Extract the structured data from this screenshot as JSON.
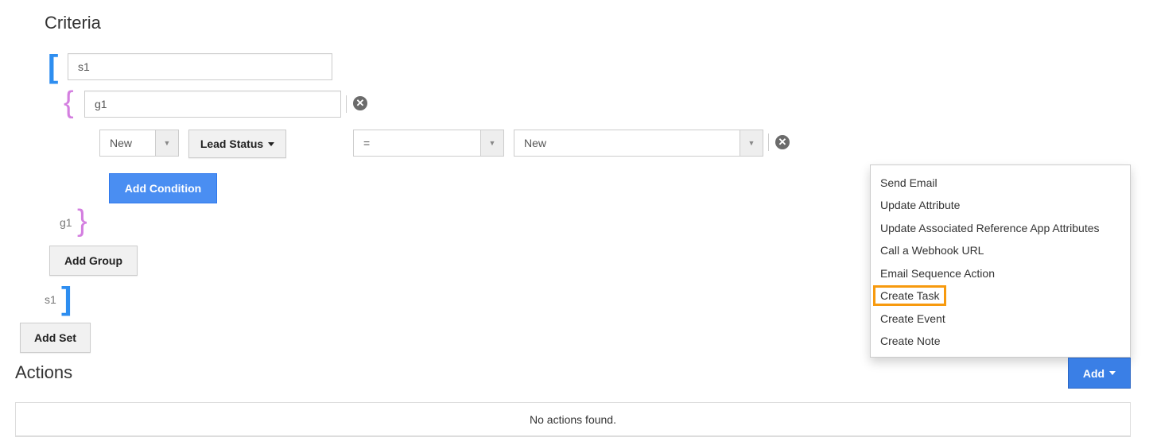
{
  "criteria": {
    "title": "Criteria",
    "set": {
      "name_value": "s1",
      "close_label": "s1",
      "group": {
        "name_value": "g1",
        "close_label": "g1",
        "condition": {
          "value_select": "New",
          "field_button": "Lead Status",
          "operator_select": "=",
          "compare_select": "New"
        },
        "add_condition_label": "Add Condition"
      },
      "add_group_label": "Add Group"
    },
    "add_set_label": "Add Set"
  },
  "actions": {
    "title": "Actions",
    "empty_message": "No actions found.",
    "add_button_label": "Add",
    "dropdown": {
      "items": [
        {
          "label": "Send Email"
        },
        {
          "label": "Update Attribute"
        },
        {
          "label": "Update Associated Reference App Attributes"
        },
        {
          "label": "Call a Webhook URL"
        },
        {
          "label": "Email Sequence Action"
        },
        {
          "label": "Create Task",
          "highlighted": true
        },
        {
          "label": "Create Event"
        },
        {
          "label": "Create Note"
        }
      ],
      "highlight_color": "#f79a0e"
    }
  },
  "colors": {
    "set_bracket": "#2e8ef0",
    "group_brace": "#d47fe0",
    "primary": "#4a8ef2"
  }
}
